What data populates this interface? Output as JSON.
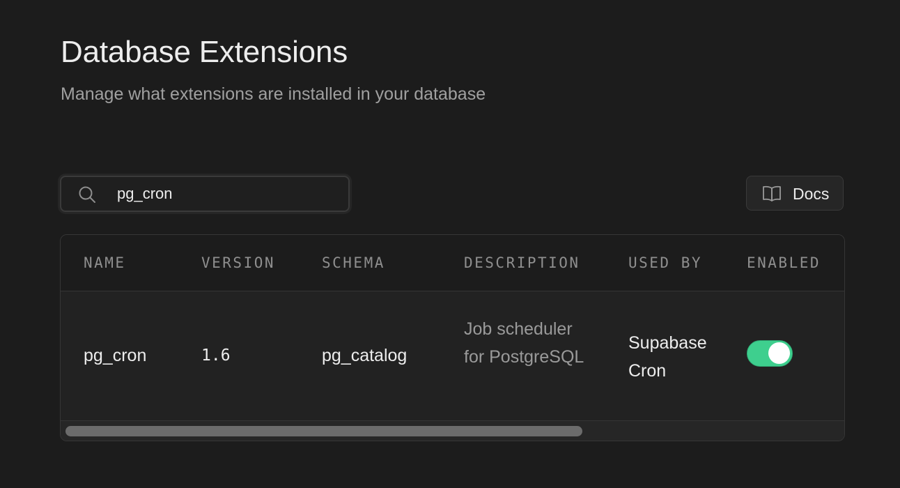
{
  "header": {
    "title": "Database Extensions",
    "subtitle": "Manage what extensions are installed in your database"
  },
  "search": {
    "value": "pg_cron",
    "icon": "search-icon"
  },
  "docs_button": {
    "label": "Docs",
    "icon": "book-open-icon"
  },
  "table": {
    "columns": [
      "NAME",
      "VERSION",
      "SCHEMA",
      "DESCRIPTION",
      "USED BY",
      "ENABLED"
    ],
    "rows": [
      {
        "name": "pg_cron",
        "version": "1.6",
        "schema": "pg_catalog",
        "description": "Job scheduler for PostgreSQL",
        "used_by": "Supabase Cron",
        "enabled": true
      }
    ]
  },
  "colors": {
    "background": "#1c1c1c",
    "accent_green": "#3ecf8e"
  }
}
